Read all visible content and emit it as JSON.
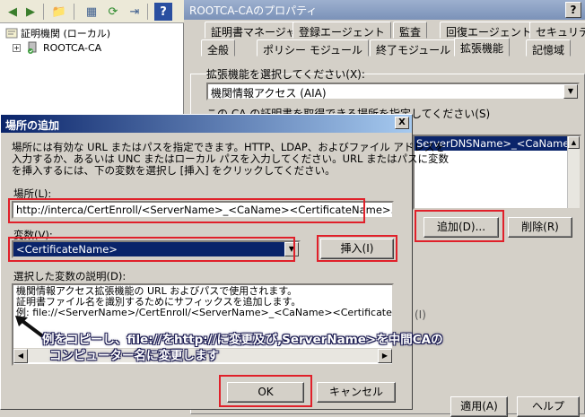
{
  "mmc": {
    "tree": {
      "root": "証明機関 (ローカル)",
      "child": "ROOTCA-CA"
    }
  },
  "props": {
    "title": "ROOTCA-CAのプロパティ",
    "help": "?",
    "tabs_row1": [
      "証明書マネージャー",
      "登録エージェント",
      "監査",
      "回復エージェント",
      "セキュリティ"
    ],
    "tabs_row2": [
      "全般",
      "ポリシー モジュール",
      "終了モジュール",
      "拡張機能",
      "記憶域"
    ],
    "select_ext_label": "拡張機能を選択してください(X):",
    "select_ext_value": "機関情報アクセス (AIA)",
    "locations_label": "この CA の証明書を取得できる場所を指定してください(S)",
    "list_item": "ServerDNSName>_<CaName><Certi",
    "add_button": "追加(D)...",
    "remove_button": "削除(R)",
    "apply_button": "適用(A)",
    "help_button": "ヘルプ",
    "side_char": "(I)"
  },
  "dialog": {
    "title": "場所の追加",
    "close": "X",
    "intro": [
      "場所には有効な URL またはパスを指定できます。HTTP、LDAP、およびファイル アドレスを",
      "入力するか、あるいは UNC またはローカル パスを入力してください。URL またはパスに変数",
      "を挿入するには、下の変数を選択し [挿入] をクリックしてください。"
    ],
    "location_label": "場所(L):",
    "location_value": "http://interca/CertEnroll/<ServerName>_<CaName><CertificateName>.crt",
    "variable_label": "変数(V):",
    "variable_value": "<CertificateName>",
    "insert_button": "挿入(I)",
    "variable_desc_label": "選択した変数の説明(D):",
    "variable_desc": [
      "機関情報アクセス拡張機能の URL およびパスで使用されます。",
      "証明書ファイル名を識別するためにサフィックスを追加します。",
      "例: file://<ServerName>/CertEnroll/<ServerName>_<CaName><CertificateName>.c"
    ],
    "ok_button": "OK",
    "cancel_button": "キャンセル"
  },
  "annotation": [
    "例をコピーし、file://をhttp://に変更及び,ServerName>を中間CAの",
    "コンピューター名に変更します"
  ],
  "colors": {
    "highlight": "#e0202a",
    "selection": "#0a246a",
    "title_active": "#0a246a"
  }
}
